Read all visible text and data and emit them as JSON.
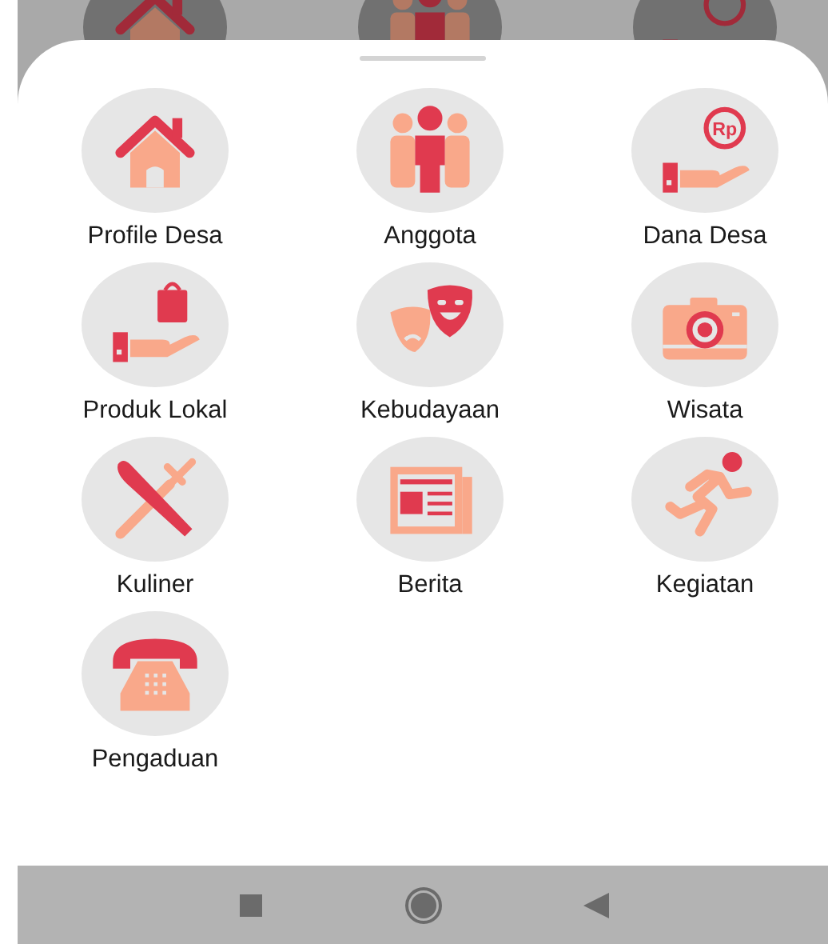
{
  "backdrop_items": [
    {
      "kind": "house"
    },
    {
      "kind": "people"
    },
    {
      "kind": "money"
    }
  ],
  "sheet": {
    "items": [
      {
        "label": "Profile Desa",
        "kind": "house"
      },
      {
        "label": "Anggota",
        "kind": "people"
      },
      {
        "label": "Dana Desa",
        "kind": "money",
        "badge_text": "Rp"
      },
      {
        "label": "Produk Lokal",
        "kind": "product"
      },
      {
        "label": "Kebudayaan",
        "kind": "masks"
      },
      {
        "label": "Wisata",
        "kind": "camera"
      },
      {
        "label": "Kuliner",
        "kind": "cutlery"
      },
      {
        "label": "Berita",
        "kind": "news"
      },
      {
        "label": "Kegiatan",
        "kind": "runner"
      },
      {
        "label": "Pengaduan",
        "kind": "phone"
      }
    ]
  },
  "nav_bar": {
    "buttons": [
      {
        "kind": "recents"
      },
      {
        "kind": "home"
      },
      {
        "kind": "back"
      }
    ]
  }
}
